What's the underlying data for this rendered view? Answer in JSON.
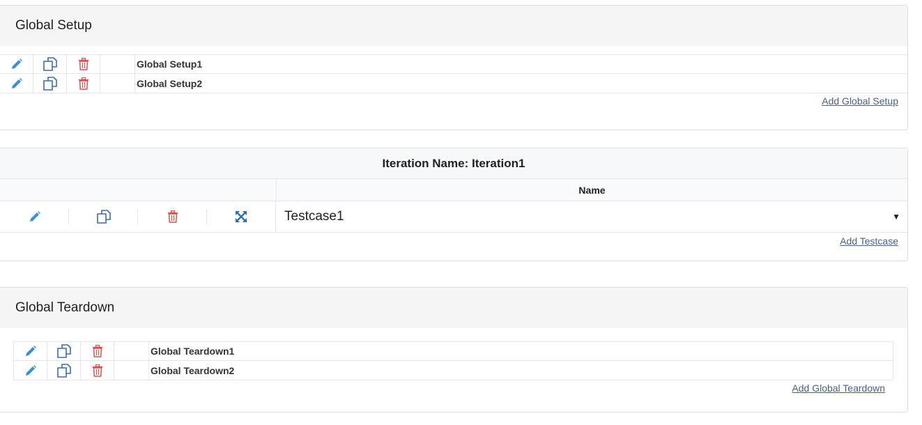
{
  "global_setup": {
    "title": "Global Setup",
    "items": [
      {
        "name": "Global Setup1"
      },
      {
        "name": "Global Setup2"
      }
    ],
    "add_label": "Add Global Setup"
  },
  "iteration": {
    "title": "Iteration Name: Iteration1",
    "column_header": "Name",
    "testcase_value": "Testcase1",
    "add_label": "Add Testcase"
  },
  "global_teardown": {
    "title": "Global Teardown",
    "items": [
      {
        "name": "Global Teardown1"
      },
      {
        "name": "Global Teardown2"
      }
    ],
    "add_label": "Add Global Teardown"
  },
  "icons": {
    "edit": "pencil-icon",
    "copy": "copy-icon",
    "delete": "trash-icon",
    "expand": "expand-icon",
    "dropdown": "caret-down-icon"
  },
  "colors": {
    "edit": "#3a8fd9",
    "copy": "#3b6ea5",
    "delete": "#d9534f",
    "link": "#4a5f8a"
  }
}
